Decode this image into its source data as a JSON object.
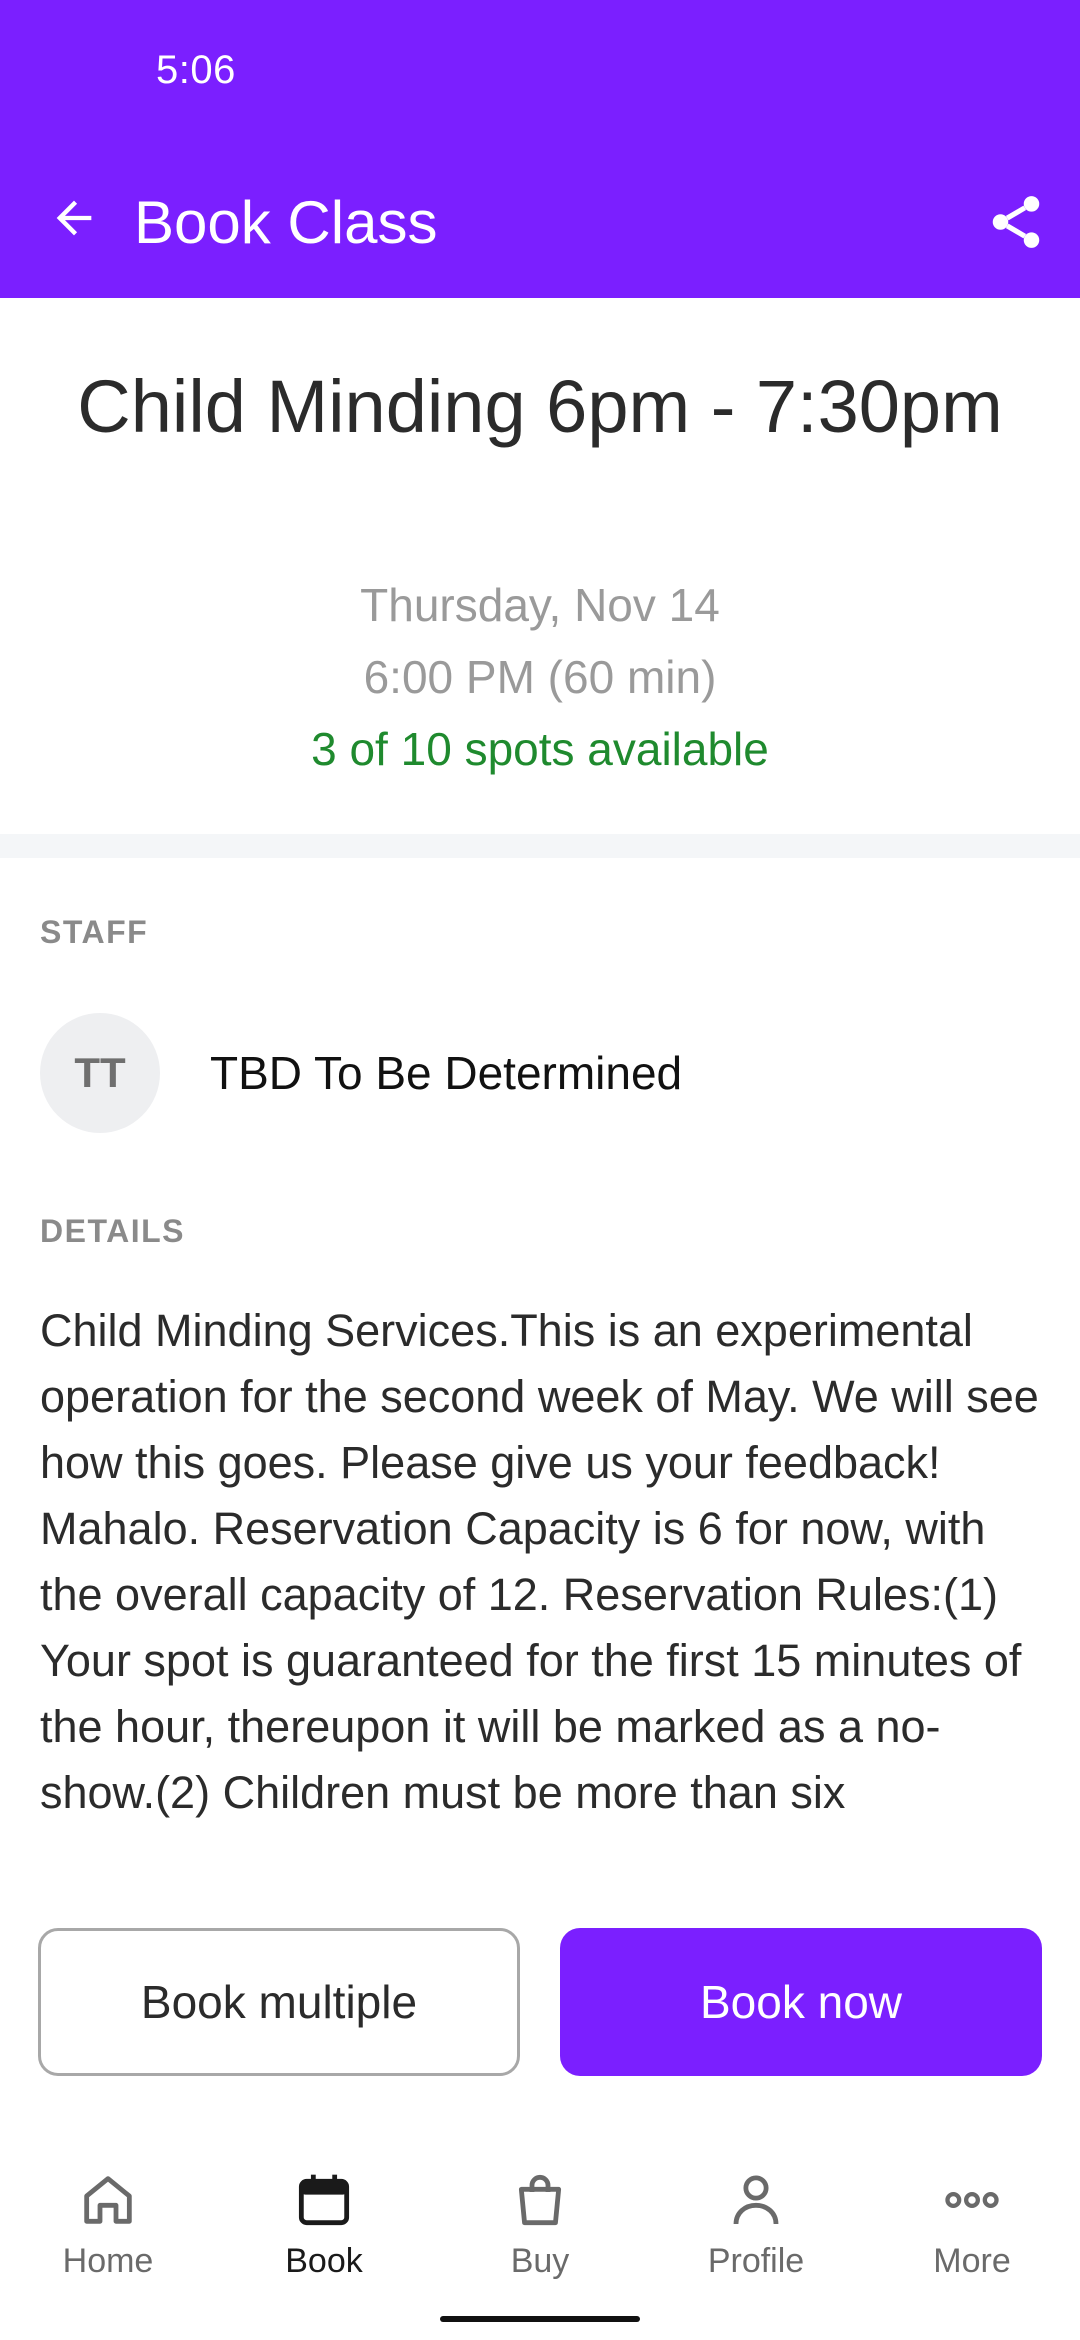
{
  "status_bar": {
    "time": "5:06"
  },
  "app_bar": {
    "title": "Book Class"
  },
  "class_info": {
    "title": "Child Minding 6pm - 7:30pm",
    "date": "Thursday, Nov 14",
    "time": "6:00 PM (60 min)",
    "availability": "3 of 10 spots available"
  },
  "staff": {
    "section_label": "STAFF",
    "initials": "TT",
    "name": "TBD To Be Determined"
  },
  "details": {
    "section_label": "DETAILS",
    "text": "Child Minding Services.This is an experimental operation for the second week of May. We will see how this goes. Please give us your feedback! Mahalo. Reservation Capacity is 6 for now, with the overall capacity of 12. Reservation Rules:(1) Your spot is guaranteed for the first 15 minutes of the hour, thereupon it will be marked as a no-show.(2) Children must be more than six"
  },
  "actions": {
    "book_multiple": "Book multiple",
    "book_now": "Book now"
  },
  "bottom_nav": {
    "items": [
      {
        "label": "Home",
        "icon": "home-icon",
        "active": false
      },
      {
        "label": "Book",
        "icon": "calendar-icon",
        "active": true
      },
      {
        "label": "Buy",
        "icon": "shopping-bag-icon",
        "active": false
      },
      {
        "label": "Profile",
        "icon": "person-icon",
        "active": false
      },
      {
        "label": "More",
        "icon": "more-dots-icon",
        "active": false
      }
    ]
  },
  "colors": {
    "primary": "#7b1fff",
    "availability_green": "#1f8a2e",
    "muted_text": "#9a9a9a"
  }
}
